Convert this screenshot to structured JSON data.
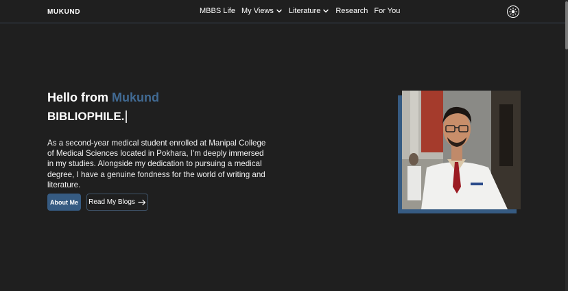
{
  "header": {
    "brand": "MUKUND",
    "nav": [
      {
        "label": "MBBS Life",
        "has_dropdown": false
      },
      {
        "label": "My Views",
        "has_dropdown": true
      },
      {
        "label": "Literature",
        "has_dropdown": true
      },
      {
        "label": "Research",
        "has_dropdown": false
      },
      {
        "label": "For You",
        "has_dropdown": false
      }
    ],
    "theme_toggle_icon": "sun-icon"
  },
  "hero": {
    "greeting": "Hello from",
    "name": "Mukund",
    "typed_word": "BIBLIOPHILE.",
    "intro": "As a second-year medical student enrolled at Manipal College of Medical Sciences located in Pokhara, I'm deeply immersed in my studies. Alongside my dedication to pursuing a medical degree, I have a genuine fondness for the world of writing and literature.",
    "about_button": "About Me",
    "blogs_button": "Read My Blogs",
    "blogs_icon": "arrow-right-icon"
  },
  "colors": {
    "background": "#1f1f1f",
    "accent": "#365b82",
    "name_accent": "#416a93"
  }
}
